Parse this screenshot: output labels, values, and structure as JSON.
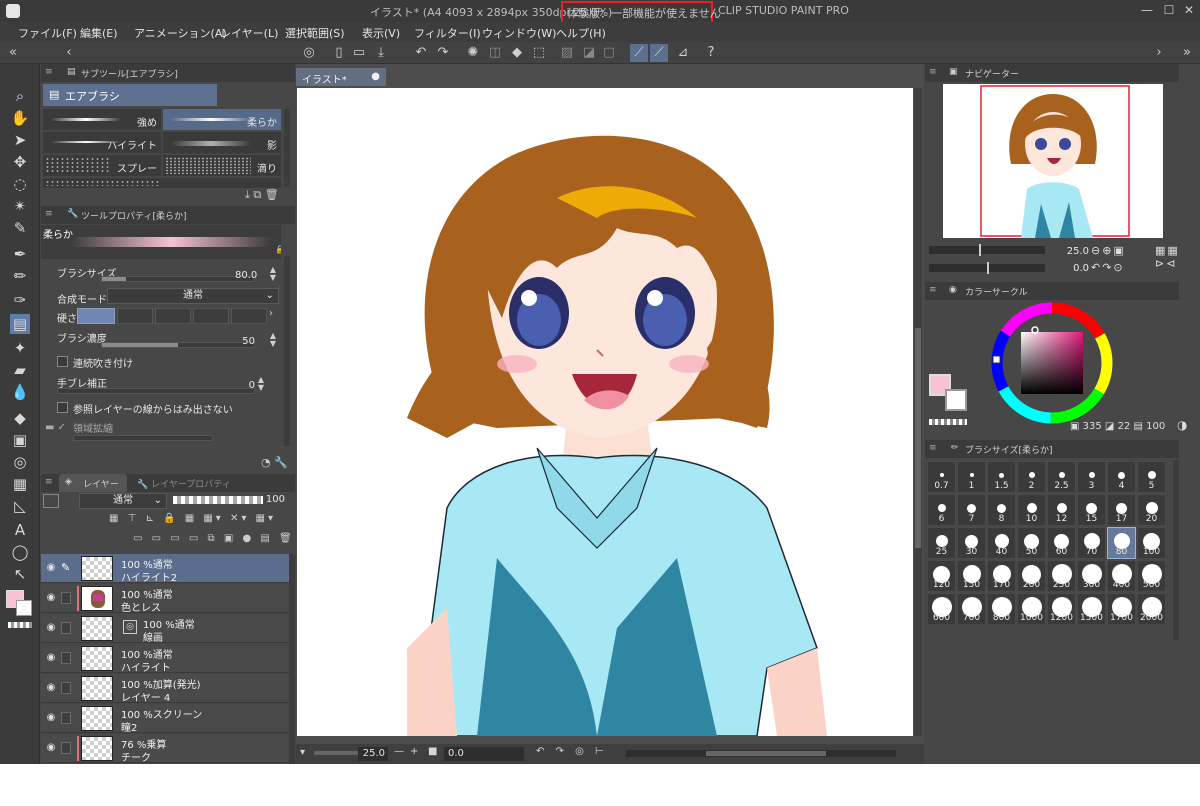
{
  "titlebar": {
    "doc_title": "イラスト* (A4 4093 x 2894px 350dpi 25.0%)",
    "trial_notice": "体験版：一部機能が使えません",
    "app_name": "CLIP STUDIO PAINT PRO",
    "highlight_color": "#e8202a"
  },
  "menu": [
    "ファイル(F)",
    "編集(E)",
    "アニメーション(A)",
    "レイヤー(L)",
    "選択範囲(S)",
    "表示(V)",
    "フィルター(I)",
    "ウィンドウ(W)",
    "ヘルプ(H)"
  ],
  "subtool": {
    "title": "サブツール[エアブラシ]",
    "group_label": "エアブラシ",
    "brushes": [
      "強め",
      "柔らか",
      "ハイライト",
      "影",
      "スプレー",
      "滴り"
    ]
  },
  "toolprop": {
    "title": "ツールプロパティ[柔らか]",
    "preset_name": "柔らか",
    "brush_size_label": "ブラシサイズ",
    "brush_size_value": "80.0",
    "brush_size_level": 0.16,
    "blend_label": "合成モード",
    "blend_value": "通常",
    "hardness_label": "硬さ",
    "density_label": "ブラシ濃度",
    "density_value": "50",
    "density_level": 0.5,
    "continuous_label": "連続吹き付け",
    "stabilizer_label": "手ブレ補正",
    "stabilizer_value": "0",
    "reference_label": "参照レイヤーの線からはみ出さない",
    "expand_label": "領域拡縮"
  },
  "layers": {
    "tab_layer": "レイヤー",
    "tab_property": "レイヤープロパティ",
    "blend_value": "通常",
    "opacity_value": "100",
    "rows": [
      {
        "mode": "100 %通常",
        "name": "ハイライト2"
      },
      {
        "mode": "100 %通常",
        "name": "色とレス"
      },
      {
        "mode": "100 %通常",
        "name": "線画"
      },
      {
        "mode": "100 %通常",
        "name": "ハイライト"
      },
      {
        "mode": "100 %加算(発光)",
        "name": "レイヤー 4"
      },
      {
        "mode": "100 %スクリーン",
        "name": "瞳2"
      },
      {
        "mode": "76 %乗算",
        "name": "チーク"
      }
    ]
  },
  "canvas": {
    "tab_label": "イラスト*",
    "zoom_value": "25.0",
    "rotate_value": "0.0"
  },
  "navigator": {
    "title": "ナビゲーター",
    "zoom_value": "25.0",
    "rotate_value": "0.0"
  },
  "color": {
    "title": "カラーサークル",
    "main_color": "#f7c3d3",
    "sub_color": "#ffffff",
    "hsv_h": "335",
    "hsv_s": "22",
    "hsv_v": "100"
  },
  "brushsize": {
    "title": "ブラシサイズ[柔らか]",
    "sizes": [
      "0.7",
      "1",
      "1.5",
      "2",
      "2.5",
      "3",
      "4",
      "5",
      "6",
      "7",
      "8",
      "10",
      "12",
      "15",
      "17",
      "20",
      "25",
      "30",
      "40",
      "50",
      "60",
      "70",
      "80",
      "100",
      "120",
      "150",
      "170",
      "200",
      "250",
      "300",
      "400",
      "500",
      "600",
      "700",
      "800",
      "1000",
      "1200",
      "1500",
      "1700",
      "2000"
    ],
    "selected": "80"
  }
}
